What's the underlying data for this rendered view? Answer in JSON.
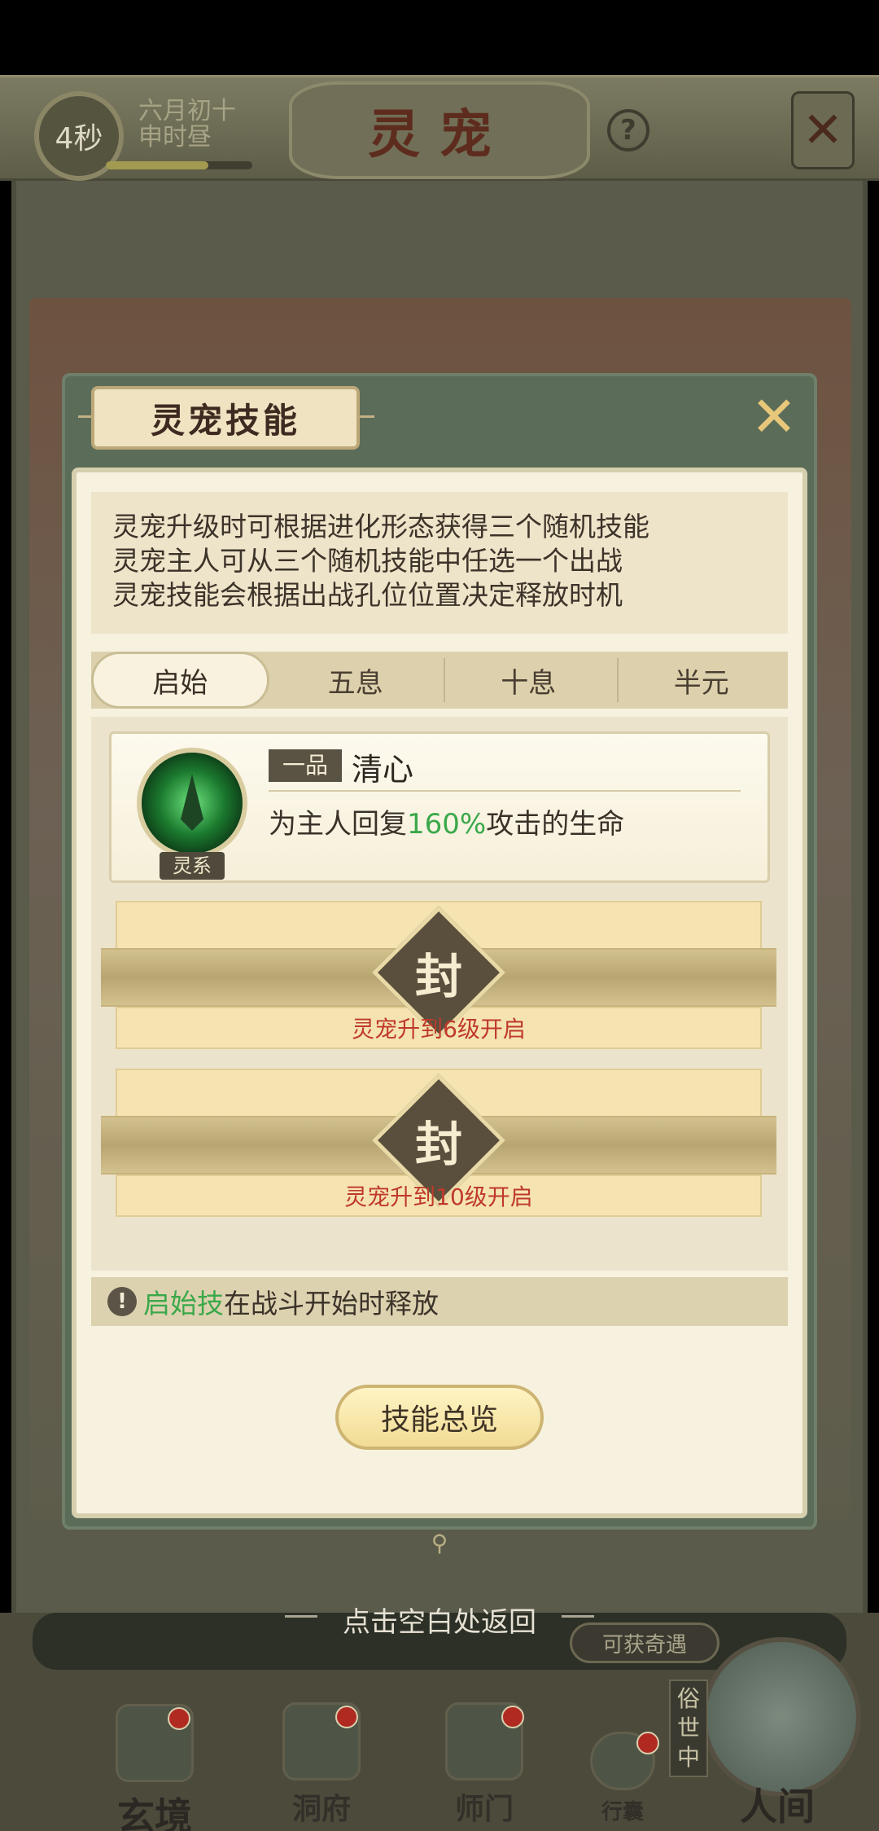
{
  "header": {
    "timer": "4秒",
    "date_line1": "六月初十",
    "date_line2": "申时昼",
    "title": "灵宠",
    "help_icon": "?",
    "close_icon": "✕"
  },
  "dialog": {
    "title": "灵宠技能",
    "close_icon": "✕",
    "description": [
      "灵宠升级时可根据进化形态获得三个随机技能",
      "灵宠主人可从三个随机技能中任选一个出战",
      "灵宠技能会根据出战孔位位置决定释放时机"
    ],
    "tabs": [
      {
        "label": "启始",
        "active": true
      },
      {
        "label": "五息",
        "active": false
      },
      {
        "label": "十息",
        "active": false
      },
      {
        "label": "半元",
        "active": false
      }
    ],
    "skill": {
      "element": "灵系",
      "grade": "一品",
      "name": "清心",
      "desc_prefix": "为主人回复",
      "desc_value": "160%",
      "desc_suffix": "攻击的生命"
    },
    "locked_slots": [
      {
        "seal": "封",
        "unlock_text": "灵宠升到6级开启"
      },
      {
        "seal": "封",
        "unlock_text": "灵宠升到10级开启"
      }
    ],
    "note": {
      "icon": "!",
      "highlight": "启始技",
      "text": "在战斗开始时释放"
    },
    "overview_button": "技能总览"
  },
  "dismiss_hint": "点击空白处返回",
  "encounter_badge": "可获奇遇",
  "world_badge": "俗世中",
  "nav": [
    {
      "label": "玄境",
      "icon": "scroll-icon"
    },
    {
      "label": "洞府",
      "icon": "lantern-icon"
    },
    {
      "label": "师门",
      "icon": "banner-icon"
    },
    {
      "label": "行囊",
      "icon": "bag-icon"
    },
    {
      "label": "人间",
      "icon": "landscape-icon"
    }
  ],
  "colors": {
    "highlight_green": "#3aa84a",
    "unlock_red": "#c0392b",
    "panel_cream": "#f7f2df"
  }
}
